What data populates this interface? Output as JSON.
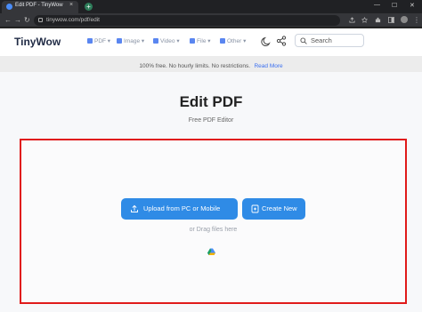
{
  "browser": {
    "tab_title": "Edit PDF - TinyWow",
    "tab_close": "×",
    "new_tab": "+",
    "url": "tinywow.com/pdf/edit",
    "min": "—",
    "max": "☐",
    "close": "✕"
  },
  "header": {
    "logo": "TinyWow",
    "menu": [
      {
        "label": "PDF",
        "icon": "pdf-icon"
      },
      {
        "label": "Image",
        "icon": "image-icon"
      },
      {
        "label": "Video",
        "icon": "video-icon"
      },
      {
        "label": "File",
        "icon": "file-icon"
      },
      {
        "label": "Other",
        "icon": "grid-icon"
      }
    ],
    "search_placeholder": "Search"
  },
  "banner": {
    "text": "100% free. No hourly limits. No restrictions.",
    "link": "Read More"
  },
  "main": {
    "title": "Edit PDF",
    "subtitle": "Free PDF Editor",
    "upload_button": "Upload from PC or Mobile",
    "create_button": "Create New",
    "drag_text": "or Drag files here"
  },
  "colors": {
    "accent": "#2f8be6",
    "highlight_border": "#e01a1a"
  }
}
